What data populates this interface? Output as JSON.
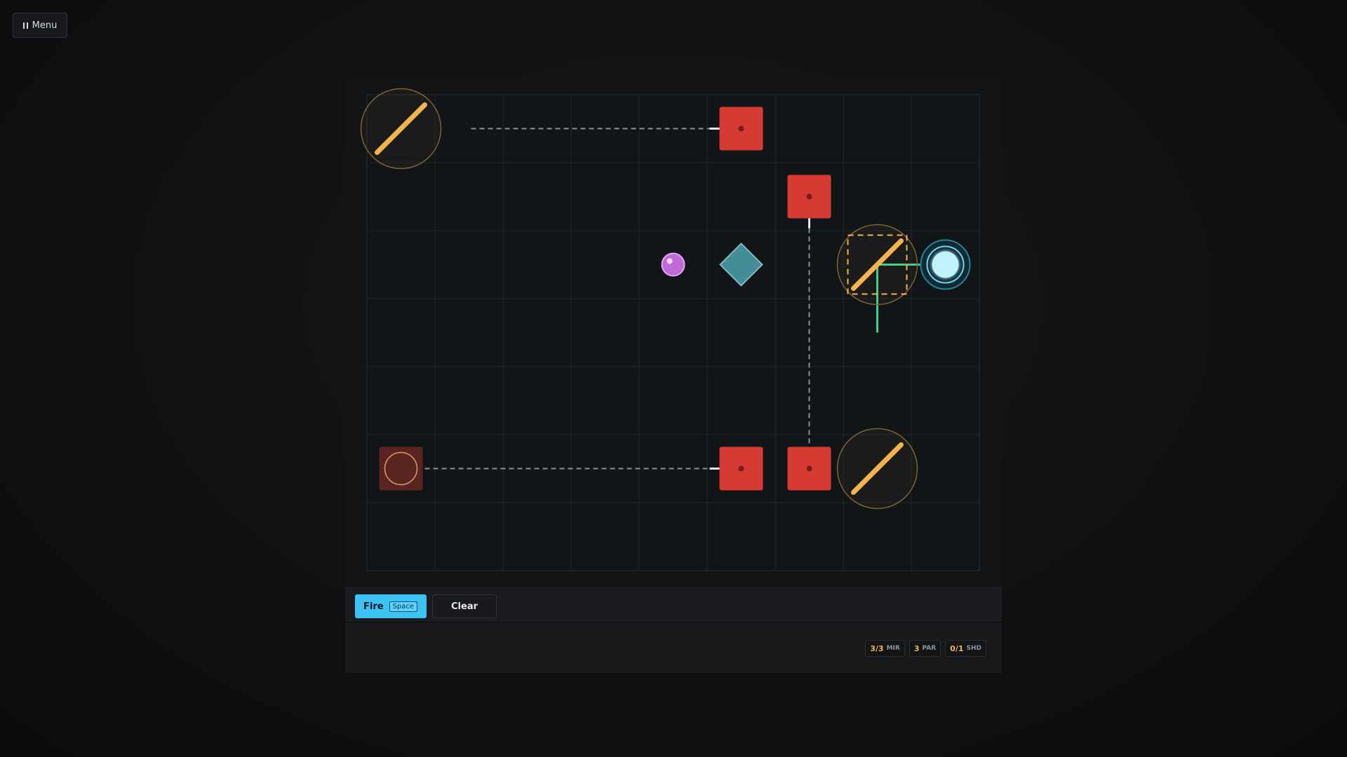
{
  "menu": {
    "label": "Menu",
    "icon": "pause-icon"
  },
  "controls": {
    "fire_label": "Fire",
    "fire_key": "Space",
    "clear_label": "Clear"
  },
  "stats": [
    {
      "value": "3/3",
      "label": "MIR"
    },
    {
      "value": "3",
      "label": "PAR"
    },
    {
      "value": "0/1",
      "label": "SHD"
    }
  ],
  "board": {
    "cols": 9,
    "rows": 7,
    "colors": {
      "grid_bg": "#111518",
      "grid_line": "#1f2529",
      "beam": "#3cc7f5",
      "beam_green": "#3ecf8e",
      "mirror": "#f4b44c",
      "target": "#d63a33",
      "emitter": "#bff4ff",
      "prism": "#4fa3ad",
      "orb": "#c06ad8"
    },
    "targets": [
      [
        5,
        0
      ],
      [
        6,
        1
      ],
      [
        5,
        5
      ],
      [
        6,
        5
      ]
    ],
    "source_target": [
      0,
      5
    ],
    "mirrors": [
      [
        0,
        0
      ],
      [
        7,
        5
      ],
      [
        7,
        2
      ]
    ],
    "selected_mirror": [
      7,
      2
    ],
    "emitter": [
      8,
      2
    ],
    "prism": [
      5,
      2
    ],
    "orb": [
      4,
      2
    ]
  }
}
